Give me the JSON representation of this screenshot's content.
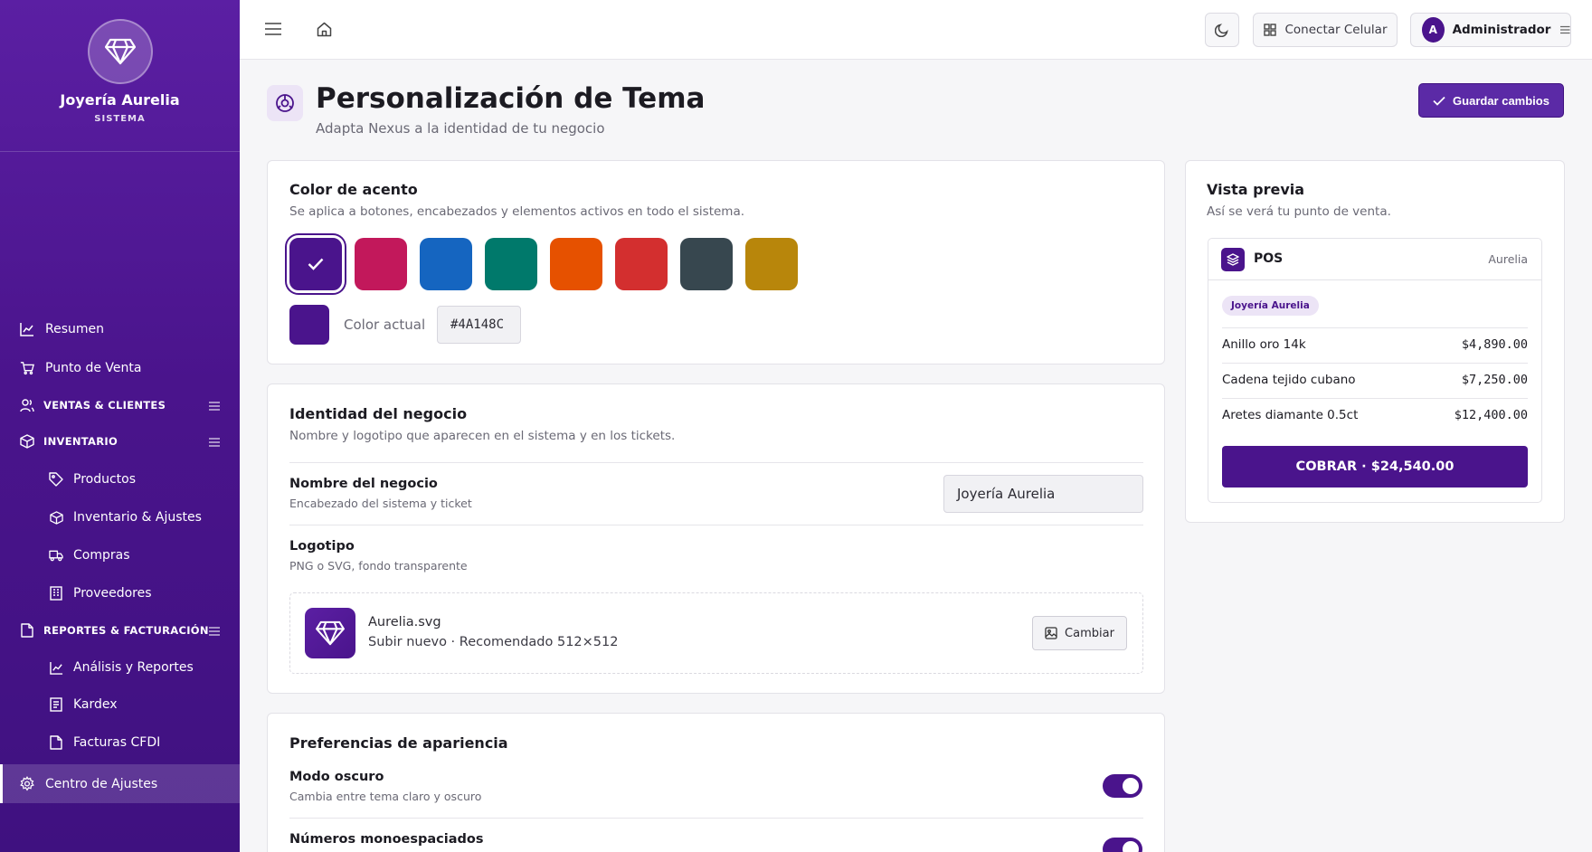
{
  "sidebar": {
    "brand_name": "Joyería Aurelia",
    "brand_sub": "SISTEMA",
    "items": [
      {
        "label": "Resumen",
        "icon": "chart-line-icon"
      },
      {
        "label": "Punto de Venta",
        "icon": "cart-icon"
      },
      {
        "label": "VENTAS & CLIENTES",
        "icon": "users-icon"
      },
      {
        "label": "INVENTARIO",
        "icon": "box-icon"
      },
      {
        "label": "Productos",
        "icon": "tag-icon"
      },
      {
        "label": "Inventario & Ajustes",
        "icon": "box-icon"
      },
      {
        "label": "Compras",
        "icon": "truck-icon"
      },
      {
        "label": "Proveedores",
        "icon": "building-icon"
      },
      {
        "label": "REPORTES & FACTURACIÓN",
        "icon": "document-icon"
      },
      {
        "label": "Análisis y Reportes",
        "icon": "chart-line-icon"
      },
      {
        "label": "Kardex",
        "icon": "ledger-icon"
      },
      {
        "label": "Facturas CFDI",
        "icon": "document-icon"
      },
      {
        "label": "Centro de Ajustes",
        "icon": "gear-icon"
      }
    ]
  },
  "topbar": {
    "connect_label": "Conectar Celular",
    "user_initial": "A",
    "user_name": "Administrador"
  },
  "page": {
    "title": "Personalización de Tema",
    "subtitle": "Adapta Nexus a la identidad de tu negocio",
    "save_label": "Guardar cambios"
  },
  "accent": {
    "title": "Color de acento",
    "desc": "Se aplica a botones, encabezados y elementos activos en todo el sistema.",
    "swatches": [
      "#4A148C",
      "#C2185B",
      "#1565C0",
      "#00796B",
      "#E65100",
      "#D32F2F",
      "#37474F",
      "#B8860B"
    ],
    "selected": "#4A148C",
    "current_label": "Color actual",
    "current_value": "#4A148C"
  },
  "identity": {
    "title": "Identidad del negocio",
    "desc": "Nombre y logotipo que aparecen en el sistema y en los tickets.",
    "name_label": "Nombre del negocio",
    "name_hint": "Encabezado del sistema y ticket",
    "name_value": "Joyería Aurelia",
    "logo_label": "Logotipo",
    "logo_hint": "PNG o SVG, fondo transparente",
    "logo_file": "Aurelia.svg",
    "logo_info": "Subir nuevo · Recomendado 512×512",
    "change_label": "Cambiar"
  },
  "appearance": {
    "title": "Preferencias de apariencia",
    "dark_label": "Modo oscuro",
    "dark_hint": "Cambia entre tema claro y oscuro",
    "dark_on": true,
    "mono_label": "Números monoespaciados",
    "mono_on": true
  },
  "preview": {
    "title": "Vista previa",
    "desc": "Así se verá tu punto de venta.",
    "pos_label": "POS",
    "pos_brand": "Aurelia",
    "chip": "Joyería Aurelia",
    "rows": [
      {
        "item": "Anillo oro 14k",
        "price": "$4,890.00"
      },
      {
        "item": "Cadena tejido cubano",
        "price": "$7,250.00"
      },
      {
        "item": "Aretes diamante 0.5ct",
        "price": "$12,400.00"
      }
    ],
    "charge_label": "COBRAR · $24,540.00"
  }
}
